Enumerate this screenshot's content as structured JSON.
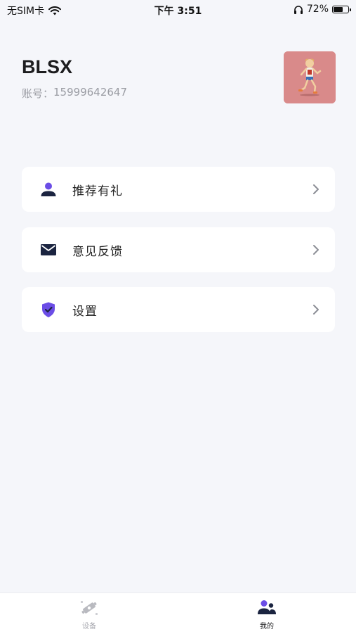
{
  "status_bar": {
    "carrier": "无SIM卡",
    "time": "下午 3:51",
    "battery": "72%",
    "battery_level": 0.72
  },
  "profile": {
    "username": "BLSX",
    "account_label": "账号：",
    "account_number": "15999642647"
  },
  "menu": {
    "items": [
      {
        "label": "推荐有礼",
        "icon": "person-icon"
      },
      {
        "label": "意见反馈",
        "icon": "envelope-icon"
      },
      {
        "label": "设置",
        "icon": "shield-check-icon"
      }
    ]
  },
  "tabbar": {
    "tabs": [
      {
        "label": "设备",
        "icon": "device-icon",
        "active": false
      },
      {
        "label": "我的",
        "icon": "people-icon",
        "active": true
      }
    ]
  },
  "colors": {
    "background": "#f5f6fa",
    "accent_purple": "#6b4de6",
    "icon_navy": "#1b2440",
    "inactive_gray": "#a8a9b0",
    "avatar_bg": "#d98a8a"
  }
}
